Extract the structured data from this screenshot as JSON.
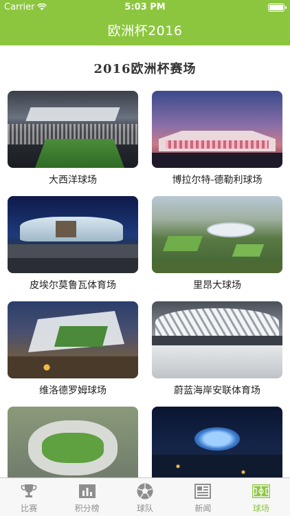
{
  "status_bar": {
    "carrier": "Carrier",
    "time": "5:03 PM"
  },
  "nav": {
    "title": "欧洲杯2016"
  },
  "section": {
    "heading": "2016欧洲杯赛场"
  },
  "venues": [
    {
      "name": "大西洋球场"
    },
    {
      "name": "博拉尔特-德勒利球场"
    },
    {
      "name": "皮埃尔莫鲁瓦体育场"
    },
    {
      "name": "里昂大球场"
    },
    {
      "name": "维洛德罗姆球场"
    },
    {
      "name": "蔚蓝海岸安联体育场"
    },
    {
      "name": ""
    },
    {
      "name": ""
    }
  ],
  "tabs": [
    {
      "label": "比赛",
      "icon": "trophy-icon"
    },
    {
      "label": "积分榜",
      "icon": "bar-chart-icon"
    },
    {
      "label": "球队",
      "icon": "soccer-ball-icon"
    },
    {
      "label": "新闻",
      "icon": "newspaper-icon"
    },
    {
      "label": "球场",
      "icon": "pitch-icon"
    }
  ],
  "colors": {
    "accent": "#8cc63f",
    "tab_inactive": "#8e8e8e"
  }
}
